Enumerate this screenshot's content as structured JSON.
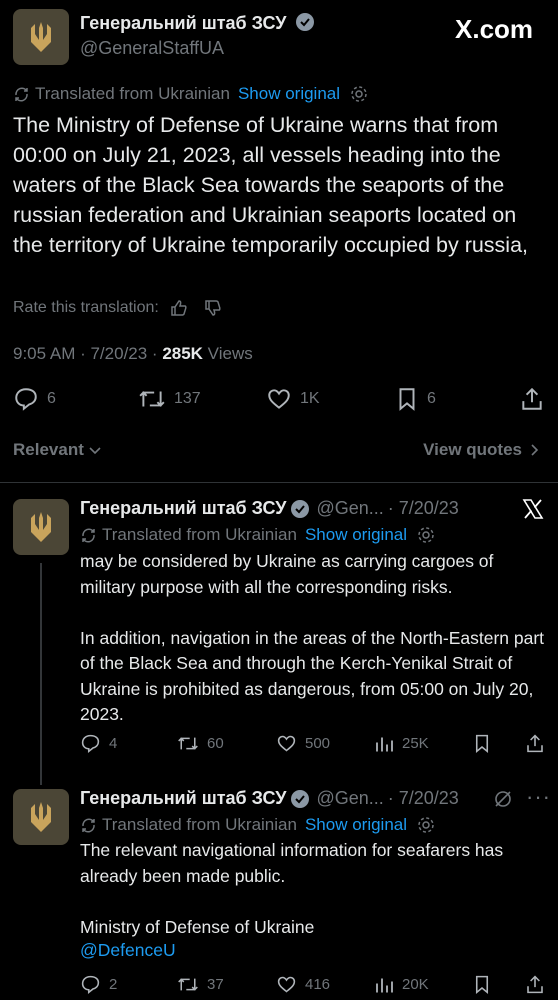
{
  "brand": {
    "watermark": "X.com"
  },
  "colors": {
    "accent": "#1d9bf0",
    "muted": "#71767b",
    "text": "#e7e9ea",
    "avatar_bg": "#4b4636",
    "trident": "#c9a45c"
  },
  "main_tweet": {
    "author_name": "Генеральний штаб ЗСУ",
    "handle": "@GeneralStaffUA",
    "translated_label": "Translated from Ukrainian",
    "show_original": "Show original",
    "text": "The Ministry of Defense of Ukraine warns that from 00:00 on July 21, 2023, all vessels heading into the waters of the Black Sea towards the seaports of the russian federation and Ukrainian seaports located on the territory of Ukraine temporarily occupied by russia,",
    "rate_label": "Rate this translation:",
    "time": "9:05 AM · 7/20/23 · ",
    "views_count": "285K",
    "views_label": " Views",
    "replies": "6",
    "reposts": "137",
    "likes": "1K",
    "bookmarks": "6"
  },
  "sort": {
    "relevant_label": "Relevant",
    "view_quotes": "View quotes"
  },
  "replies": [
    {
      "author_name": "Генеральний штаб ЗСУ",
      "handle": "@Gen...",
      "date": "· 7/20/23",
      "translated_label": "Translated from Ukrainian",
      "show_original": "Show original",
      "text": "may be considered by Ukraine as carrying cargoes of military purpose with all the corresponding risks.\n\nIn addition, navigation in the areas of the North-Eastern part of the Black Sea and through the Kerch-Yenikal Strait of Ukraine is prohibited as dangerous, from 05:00 on July 20, 2023.",
      "replies": "4",
      "reposts": "60",
      "likes": "500",
      "views": "25K"
    },
    {
      "author_name": "Генеральний штаб ЗСУ",
      "handle": "@Gen...",
      "date": "· 7/20/23",
      "translated_label": "Translated from Ukrainian",
      "show_original": "Show original",
      "text": "The relevant navigational information for seafarers has already been made public.\n\nMinistry of Defense of Ukraine",
      "mention": "@DefenceU",
      "replies": "2",
      "reposts": "37",
      "likes": "416",
      "views": "20K"
    }
  ]
}
